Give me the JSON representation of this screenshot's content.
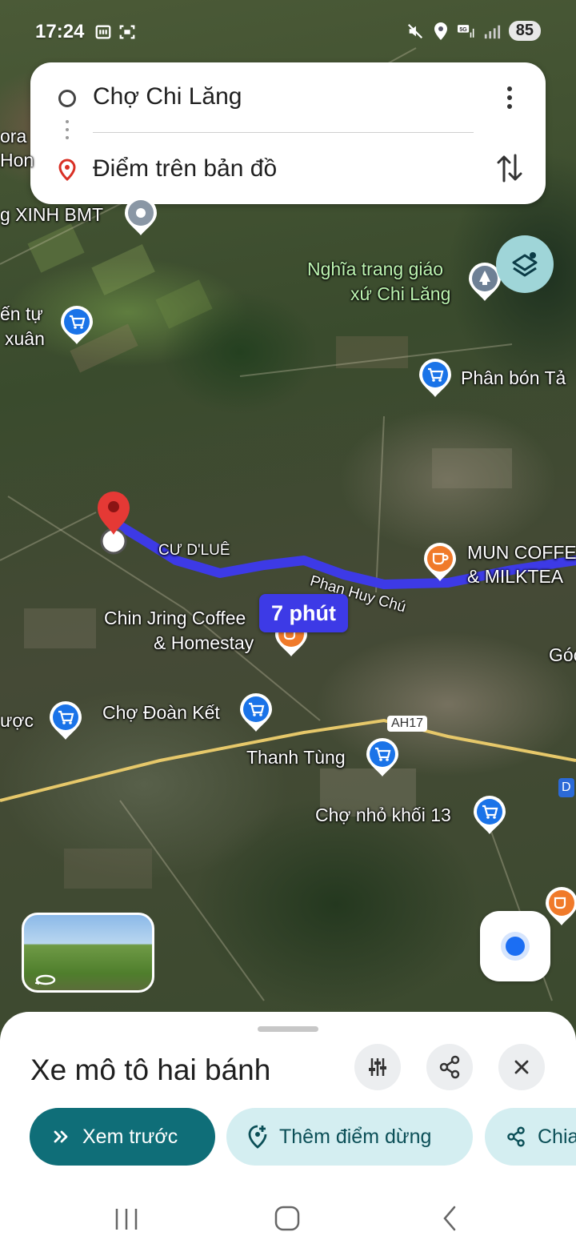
{
  "status_bar": {
    "time": "17:24",
    "battery": "85",
    "network": "5G"
  },
  "route": {
    "origin": "Chợ Chi Lăng",
    "destination": "Điểm trên bản đồ"
  },
  "map": {
    "travel_time": "7 phút",
    "labels": {
      "edge_top_1": "ora",
      "edge_top_2": "Hon",
      "xinh_bmt": "g XINH BMT",
      "nghia_trang_1": "Nghĩa trang giáo",
      "nghia_trang_2": "xứ Chi Lăng",
      "sieu_thi_1": "ến tự",
      "sieu_thi_2": "xuân",
      "phan_bon": "Phân bón Tả",
      "cu_dlue": "CƯ D'LUÊ",
      "phan_huy_chu": "Phan Huy Chú",
      "mun_1": "MUN COFFE",
      "mun_2": "& MILKTEA",
      "chin_jring_1": "Chin Jring Coffee",
      "chin_jring_2": "& Homestay",
      "goc": "Góc",
      "duoc": "ược",
      "cho_doan_ket": "Chợ Đoàn Kết",
      "ah17": "AH17",
      "thanh_tung": "Thanh Tùng",
      "cho_nho": "Chợ nhỏ khối 13",
      "edge_d": "D"
    }
  },
  "sheet": {
    "title": "Xe mô tô hai bánh",
    "preview_label": "Xem trước",
    "add_stop_label": "Thêm điểm dừng",
    "share_label": "Chia"
  },
  "colors": {
    "route": "#3d3ae6",
    "primary_chip": "#0f6e78",
    "secondary_chip": "#d4eef1",
    "shop_pin": "#1a73e8",
    "cafe_pin": "#f07a2a"
  }
}
